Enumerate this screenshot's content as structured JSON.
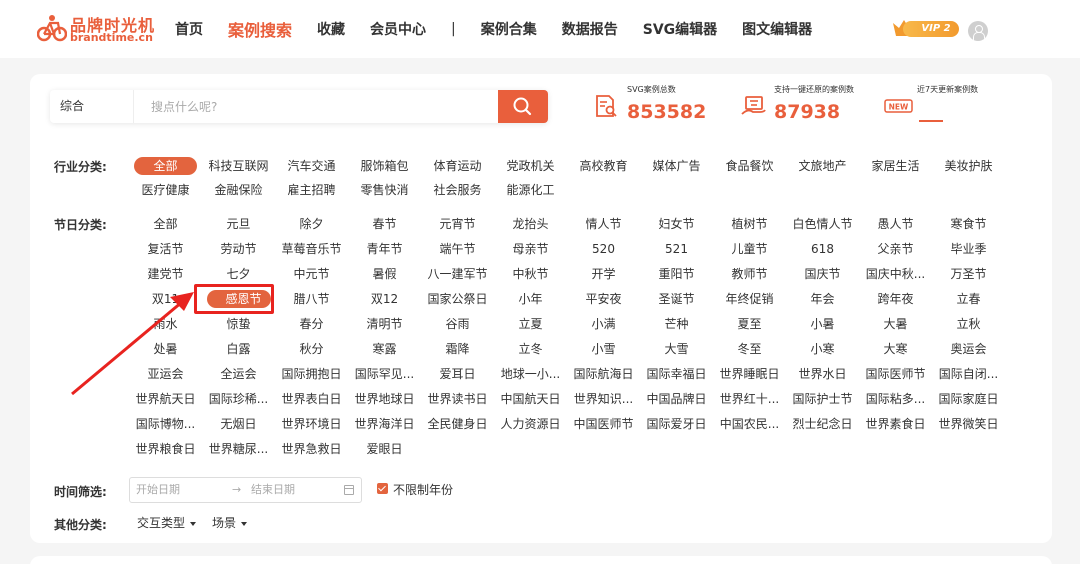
{
  "brand": {
    "name_cn": "品牌时光机",
    "domain": "brandtime.cn",
    "accent": "#e95f3c"
  },
  "nav": [
    {
      "label": "首页",
      "active": false
    },
    {
      "label": "案例搜索",
      "active": true
    },
    {
      "label": "收藏",
      "active": false
    },
    {
      "label": "会员中心",
      "active": false
    },
    {
      "label": "|",
      "sep": true
    },
    {
      "label": "案例合集",
      "active": false
    },
    {
      "label": "数据报告",
      "active": false
    },
    {
      "label": "SVG编辑器",
      "active": false
    },
    {
      "label": "图文编辑器",
      "active": false
    }
  ],
  "vip": {
    "label": "VIP 2"
  },
  "search": {
    "type": "综合",
    "placeholder": "搜点什么呢?"
  },
  "stats": [
    {
      "label": "SVG案例总数",
      "value": "853582",
      "icon": "document-search-icon"
    },
    {
      "label": "支持一键还原的案例数",
      "value": "87938",
      "icon": "restore-hand-icon"
    },
    {
      "label": "近7天更新案例数",
      "value": "",
      "icon": "new-badge-icon"
    }
  ],
  "industry": {
    "label": "行业分类:",
    "selected": "全部",
    "items": [
      "全部",
      "科技互联网",
      "汽车交通",
      "服饰箱包",
      "体育运动",
      "党政机关",
      "高校教育",
      "媒体广告",
      "食品餐饮",
      "文旅地产",
      "家居生活",
      "美妆护肤",
      "医疗健康",
      "金融保险",
      "雇主招聘",
      "零售快消",
      "社会服务",
      "能源化工"
    ]
  },
  "festival": {
    "label": "节日分类:",
    "selected": "感恩节",
    "items": [
      "全部",
      "元旦",
      "除夕",
      "春节",
      "元宵节",
      "龙抬头",
      "情人节",
      "妇女节",
      "植树节",
      "白色情人节",
      "愚人节",
      "寒食节",
      "复活节",
      "劳动节",
      "草莓音乐节",
      "青年节",
      "端午节",
      "母亲节",
      "520",
      "521",
      "儿童节",
      "618",
      "父亲节",
      "毕业季",
      "建党节",
      "七夕",
      "中元节",
      "暑假",
      "八一建军节",
      "中秋节",
      "开学",
      "重阳节",
      "教师节",
      "国庆节",
      "国庆中秋...",
      "万圣节",
      "双11",
      "感恩节",
      "腊八节",
      "双12",
      "国家公祭日",
      "小年",
      "平安夜",
      "圣诞节",
      "年终促销",
      "年会",
      "跨年夜",
      "立春",
      "雨水",
      "惊蛰",
      "春分",
      "清明节",
      "谷雨",
      "立夏",
      "小满",
      "芒种",
      "夏至",
      "小暑",
      "大暑",
      "立秋",
      "处暑",
      "白露",
      "秋分",
      "寒露",
      "霜降",
      "立冬",
      "小雪",
      "大雪",
      "冬至",
      "小寒",
      "大寒",
      "奥运会",
      "亚运会",
      "全运会",
      "国际拥抱日",
      "国际罕见...",
      "爱耳日",
      "地球一小...",
      "国际航海日",
      "国际幸福日",
      "世界睡眠日",
      "世界水日",
      "国际医师节",
      "国际自闭...",
      "世界航天日",
      "国际珍稀...",
      "世界表白日",
      "世界地球日",
      "世界读书日",
      "中国航天日",
      "世界知识...",
      "中国品牌日",
      "世界红十...",
      "国际护士节",
      "国际粘多...",
      "国际家庭日",
      "国际博物...",
      "无烟日",
      "世界环境日",
      "世界海洋日",
      "全民健身日",
      "人力资源日",
      "中国医师节",
      "国际爱牙日",
      "中国农民...",
      "烈士纪念日",
      "世界素食日",
      "世界微笑日",
      "世界粮食日",
      "世界糖尿...",
      "世界急救日",
      "爱眼日"
    ]
  },
  "time_filter": {
    "label": "时间筛选:",
    "start": "开始日期",
    "arrow": "→",
    "end": "结束日期",
    "checkbox_label": "不限制年份",
    "checked": true
  },
  "other": {
    "label": "其他分类:",
    "dropdowns": [
      "交互类型",
      "场景"
    ]
  }
}
